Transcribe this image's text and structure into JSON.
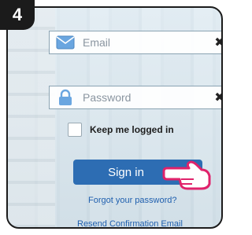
{
  "step": {
    "number": "4"
  },
  "form": {
    "email": {
      "placeholder": "Email",
      "icon": "envelope-icon",
      "clear_icon": "close-icon"
    },
    "password": {
      "placeholder": "Password",
      "icon": "lock-icon",
      "clear_icon": "close-icon"
    },
    "keep_logged_in": {
      "label": "Keep me logged in",
      "checked": false
    },
    "signin": {
      "label": "Sign in"
    },
    "links": {
      "forgot": "Forgot your password?",
      "resend": "Resend Confirmation Email"
    }
  },
  "colors": {
    "primary": "#2d6db3",
    "link": "#1f5fae",
    "highlight": "#e0226b"
  }
}
